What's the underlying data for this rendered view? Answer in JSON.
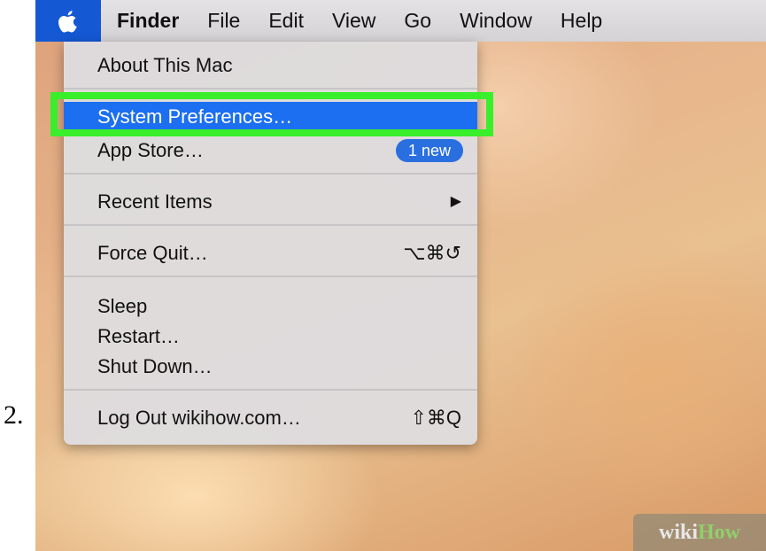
{
  "step_number": "2.",
  "menubar": {
    "apple_icon": "apple-logo-icon",
    "items": [
      "Finder",
      "File",
      "Edit",
      "View",
      "Go",
      "Window",
      "Help"
    ]
  },
  "apple_menu": {
    "about": "About This Mac",
    "system_preferences": "System Preferences…",
    "app_store": "App Store…",
    "app_store_badge": "1 new",
    "recent_items": "Recent Items",
    "recent_items_arrow": "▶",
    "force_quit": "Force Quit…",
    "force_quit_shortcut": "⌥⌘↺",
    "sleep": "Sleep",
    "restart": "Restart…",
    "shut_down": "Shut Down…",
    "log_out": "Log Out wikihow.com…",
    "log_out_shortcut": "⇧⌘Q"
  },
  "watermark": {
    "part1": "wiki",
    "part2": "How"
  },
  "colors": {
    "highlight": "#1c6ff0",
    "annotation_box": "#39ee2a",
    "apple_menu_active": "#1458d4"
  }
}
